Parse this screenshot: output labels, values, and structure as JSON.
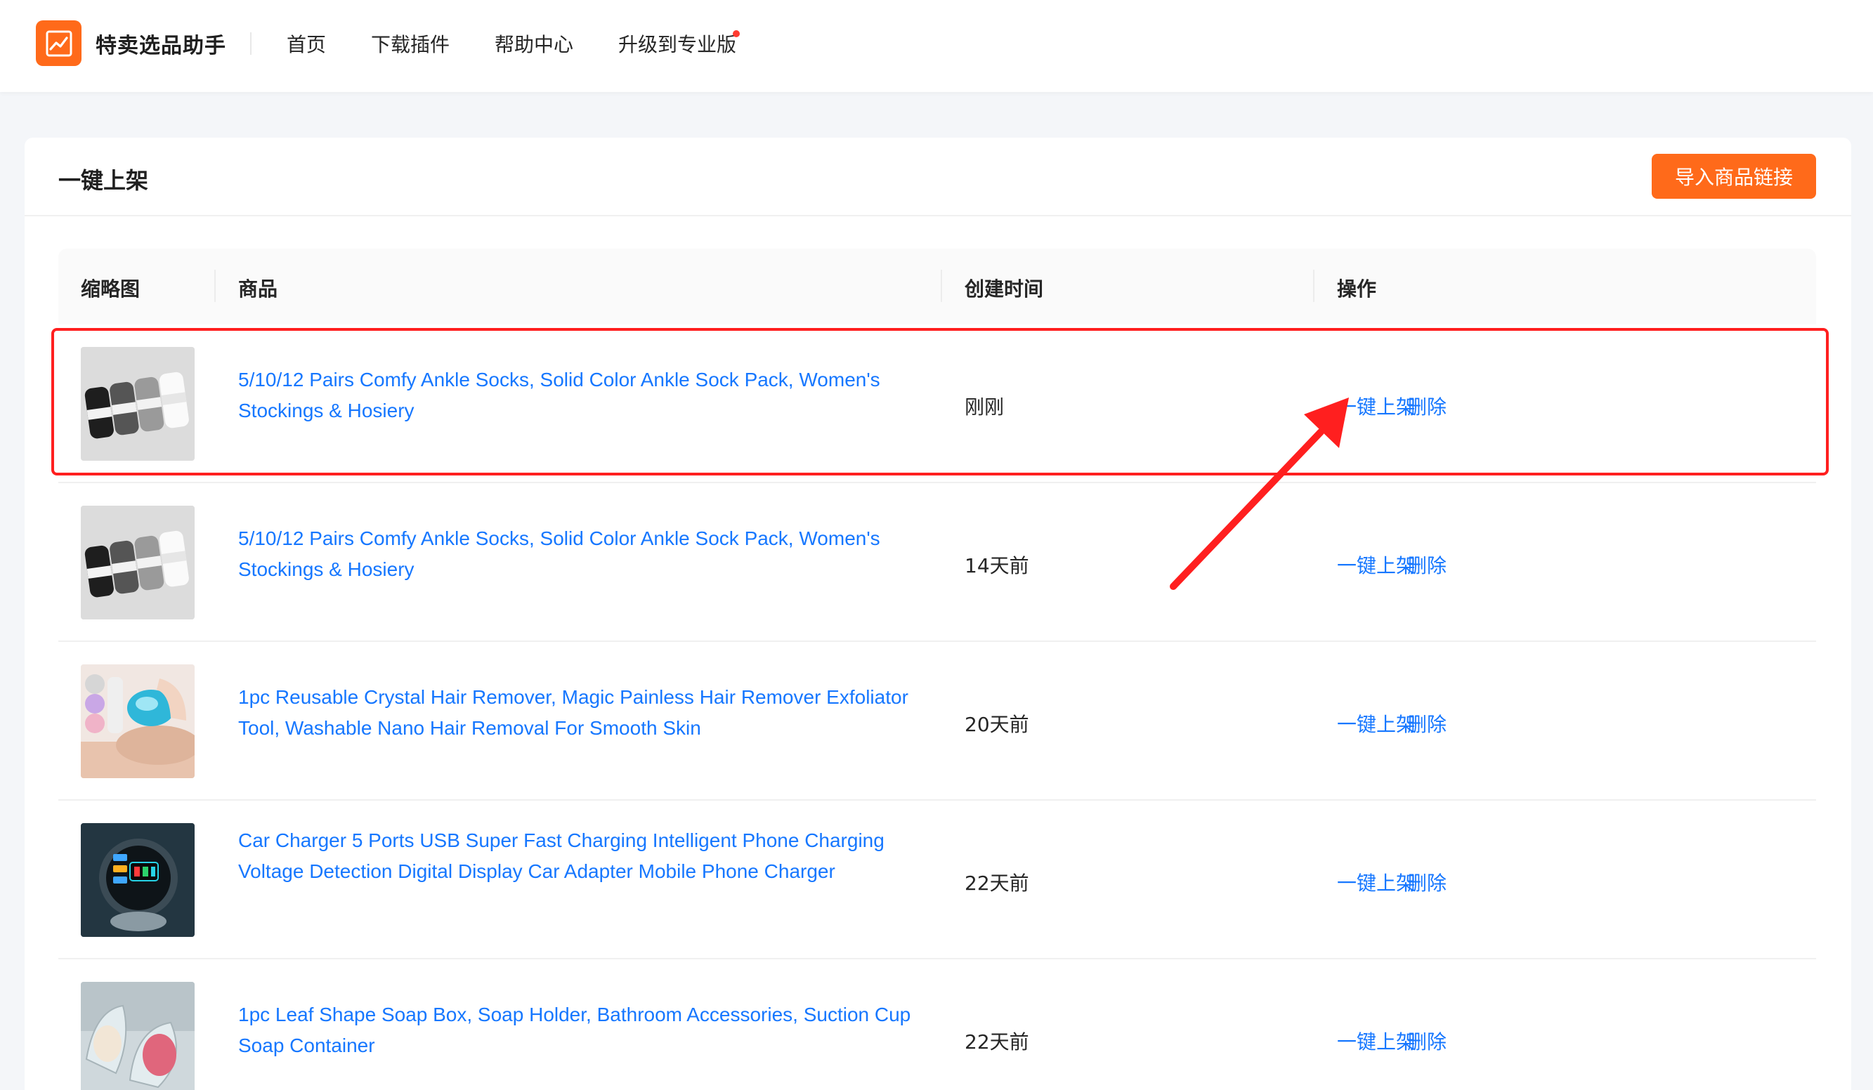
{
  "header": {
    "app_title": "特卖选品助手",
    "nav": [
      "首页",
      "下载插件",
      "帮助中心",
      "升级到专业版"
    ],
    "brand_color": "#ff6a1a",
    "logo_icon": "trend-chart-icon"
  },
  "card": {
    "title": "一键上架",
    "import_button": "导入商品链接"
  },
  "table": {
    "columns": [
      "缩略图",
      "商品",
      "创建时间",
      "操作"
    ],
    "rows": [
      {
        "thumb": "socks",
        "title": "5/10/12 Pairs Comfy Ankle Socks, Solid Color Ankle Sock Pack, Women's Stockings & Hosiery",
        "time": "刚刚",
        "action_list": "一键上架",
        "action_delete": "删除"
      },
      {
        "thumb": "socks",
        "title": "5/10/12 Pairs Comfy Ankle Socks, Solid Color Ankle Sock Pack, Women's Stockings & Hosiery",
        "time": "14天前",
        "action_list": "一键上架",
        "action_delete": "删除"
      },
      {
        "thumb": "hair-remover",
        "title": "1pc Reusable Crystal Hair Remover, Magic Painless Hair Remover Exfoliator Tool, Washable Nano Hair Removal For Smooth Skin",
        "time": "20天前",
        "action_list": "一键上架",
        "action_delete": "删除"
      },
      {
        "thumb": "car-charger",
        "title": "Car Charger 5 Ports USB Super Fast Charging Intelligent Phone Charging Voltage Detection Digital Display Car Adapter Mobile Phone Charger",
        "time": "22天前",
        "action_list": "一键上架",
        "action_delete": "删除"
      },
      {
        "thumb": "soap-box",
        "title": "1pc Leaf Shape Soap Box, Soap Holder, Bathroom Accessories, Suction Cup Soap Container",
        "time": "22天前",
        "action_list": "一键上架",
        "action_delete": "删除"
      }
    ]
  },
  "annotation": {
    "highlight_color": "#ff1f1f"
  },
  "colors": {
    "link": "#1677ff",
    "accent": "#ff6a1a"
  }
}
